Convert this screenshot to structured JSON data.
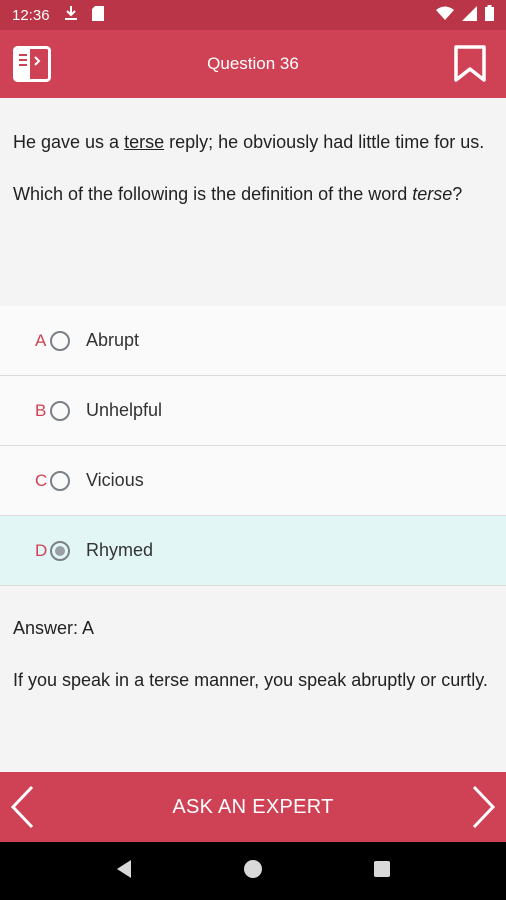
{
  "status_bar": {
    "time": "12:36"
  },
  "header": {
    "title": "Question 36"
  },
  "question": {
    "sentence_before": "He gave us a ",
    "sentence_word": "terse",
    "sentence_after": " reply; he obviously had little time for us.",
    "prompt_before": "Which of the following is the definition of the word ",
    "prompt_word": "terse",
    "prompt_after": "?"
  },
  "options": [
    {
      "letter": "A",
      "text": "Abrupt",
      "selected": false
    },
    {
      "letter": "B",
      "text": "Unhelpful",
      "selected": false
    },
    {
      "letter": "C",
      "text": "Vicious",
      "selected": false
    },
    {
      "letter": "D",
      "text": "Rhymed",
      "selected": true
    }
  ],
  "answer": {
    "label": "Answer: A",
    "explanation": "If you speak in a terse manner, you speak abruptly or curtly."
  },
  "footer": {
    "ask_label": "ASK AN EXPERT"
  },
  "colors": {
    "brand": "#cf4255",
    "status_bar": "#b93547",
    "selected_bg": "#e3f6f6"
  },
  "icons": {
    "status": [
      "download-icon",
      "sd-card-icon",
      "wifi-icon",
      "signal-icon",
      "battery-icon"
    ],
    "header": [
      "book-icon",
      "bookmark-icon"
    ],
    "footer": [
      "chevron-left-icon",
      "chevron-right-icon"
    ],
    "system": [
      "back-icon",
      "home-icon",
      "recents-icon"
    ]
  }
}
